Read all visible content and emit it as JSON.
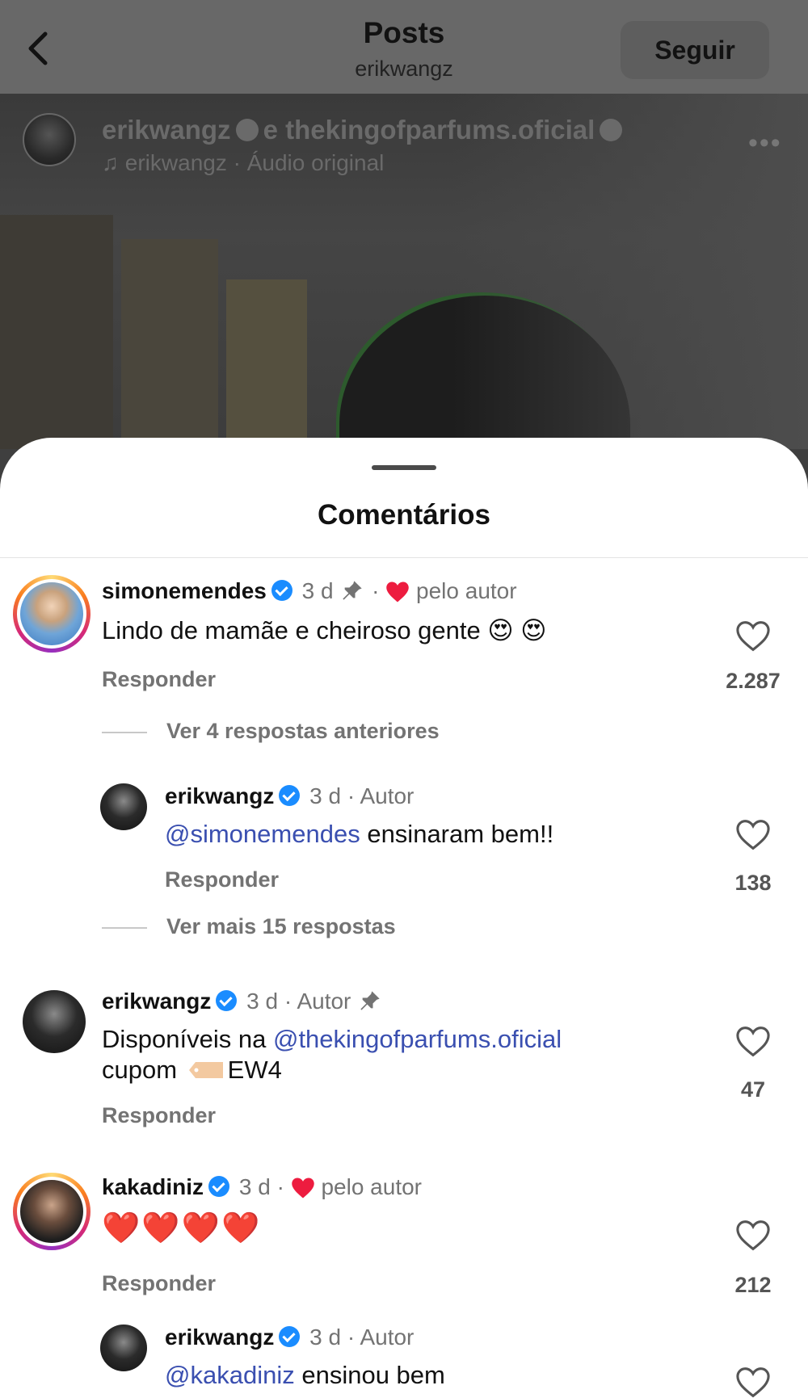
{
  "header": {
    "title": "Posts",
    "subtitle": "erikwangz",
    "follow_label": "Seguir"
  },
  "video": {
    "author": "erikwangz",
    "connector": "e",
    "collab": "thekingofparfums.oficial",
    "audio_user": "erikwangz",
    "audio_label": "· Áudio original"
  },
  "sheet": {
    "title": "Comentários"
  },
  "comments": [
    {
      "user": "simonemendes",
      "time": "3 d",
      "liked_by": "pelo autor",
      "text": "Lindo de mamãe e cheiroso gente 😍 😍",
      "reply": "Responder",
      "likes": "2.287",
      "more": "Ver 4 respostas anteriores"
    },
    {
      "user": "erikwangz",
      "time": "3 d",
      "role": "· Autor",
      "mention": "@simonemendes",
      "text": "ensinaram bem!!",
      "reply": "Responder",
      "likes": "138",
      "more": "Ver mais 15 respostas"
    },
    {
      "user": "erikwangz",
      "time": "3 d",
      "role": "· Autor",
      "text_pre": "Disponíveis na",
      "mention": "@thekingofparfums.oficial",
      "line2_pre": "cupom",
      "line2_code": "EW4",
      "reply": "Responder",
      "likes": "47"
    },
    {
      "user": "kakadiniz",
      "time": "3 d",
      "liked_by": "pelo autor",
      "text": "❤️❤️❤️❤️",
      "reply": "Responder",
      "likes": "212"
    },
    {
      "user": "erikwangz",
      "time": "3 d",
      "role": "· Autor",
      "mention": "@kakadiniz",
      "text": "ensinou bem"
    }
  ],
  "colors": {
    "verified": "#1a8cff",
    "mention": "#3a4fb0",
    "heart_red": "#ed1c3f",
    "overlay": "#686868"
  },
  "icons": [
    "back-arrow-icon",
    "verified-badge-icon",
    "music-note-icon",
    "more-icon",
    "pin-icon",
    "heart-icon",
    "tag-icon"
  ]
}
